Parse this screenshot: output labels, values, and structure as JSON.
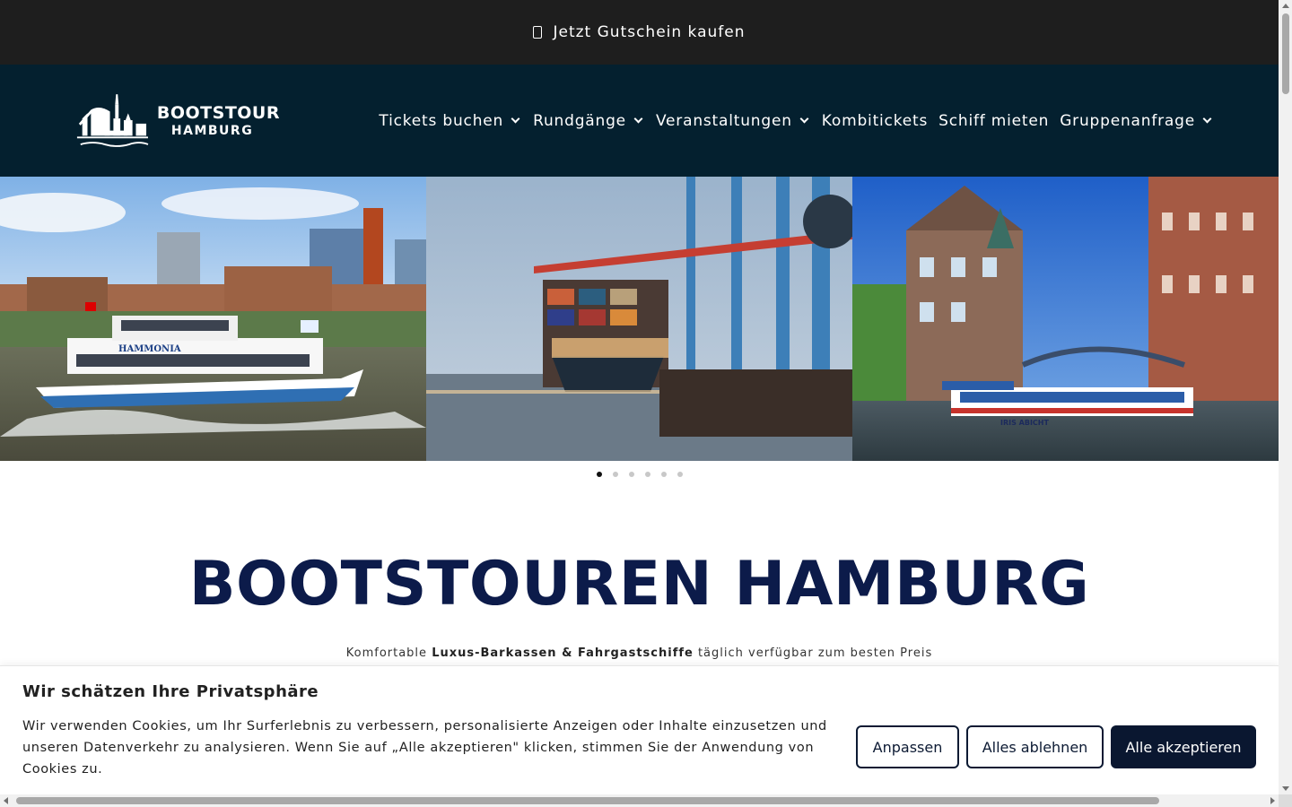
{
  "promo": {
    "icon": "gift-icon",
    "text": "Jetzt Gutschein kaufen"
  },
  "header": {
    "logo": {
      "line1": "BOOTSTOUR",
      "line2": "HAMBURG"
    },
    "nav": [
      {
        "label": "Tickets buchen",
        "dropdown": true
      },
      {
        "label": "Rundgänge",
        "dropdown": true
      },
      {
        "label": "Veranstaltungen",
        "dropdown": true
      },
      {
        "label": "Kombitickets",
        "dropdown": false
      },
      {
        "label": "Schiff mieten",
        "dropdown": false
      },
      {
        "label": "Gruppenanfrage",
        "dropdown": true
      }
    ]
  },
  "hero": {
    "slides": [
      {
        "name": "ship-hammonia",
        "boat_label": "HAMMONIA"
      },
      {
        "name": "container-terminal"
      },
      {
        "name": "speicherstadt-barkasse",
        "boat_label": "IRIS ABICHT"
      }
    ],
    "dots_total": 6,
    "dots_active_index": 0
  },
  "main": {
    "headline": "BOOTSTOUREN HAMBURG",
    "subline_pre": "Komfortable ",
    "subline_bold": "Luxus-Barkassen & Fahrgastschiffe",
    "subline_post": " täglich verfügbar zum besten Preis"
  },
  "cookie": {
    "title": "Wir schätzen Ihre Privatsphäre",
    "text": "Wir verwenden Cookies, um Ihr Surferlebnis zu verbessern, personalisierte Anzeigen oder Inhalte einzusetzen und unseren Datenverkehr zu analysieren. Wenn Sie auf „Alle akzeptieren\" klicken, stimmen Sie der Anwendung von Cookies zu.",
    "btn_customize": "Anpassen",
    "btn_reject": "Alles ablehnen",
    "btn_accept": "Alle akzeptieren"
  },
  "colors": {
    "promo_bg": "#1e1e1e",
    "header_bg": "#04202f",
    "headline": "#0c1b4a",
    "button_dark": "#0a1730"
  }
}
